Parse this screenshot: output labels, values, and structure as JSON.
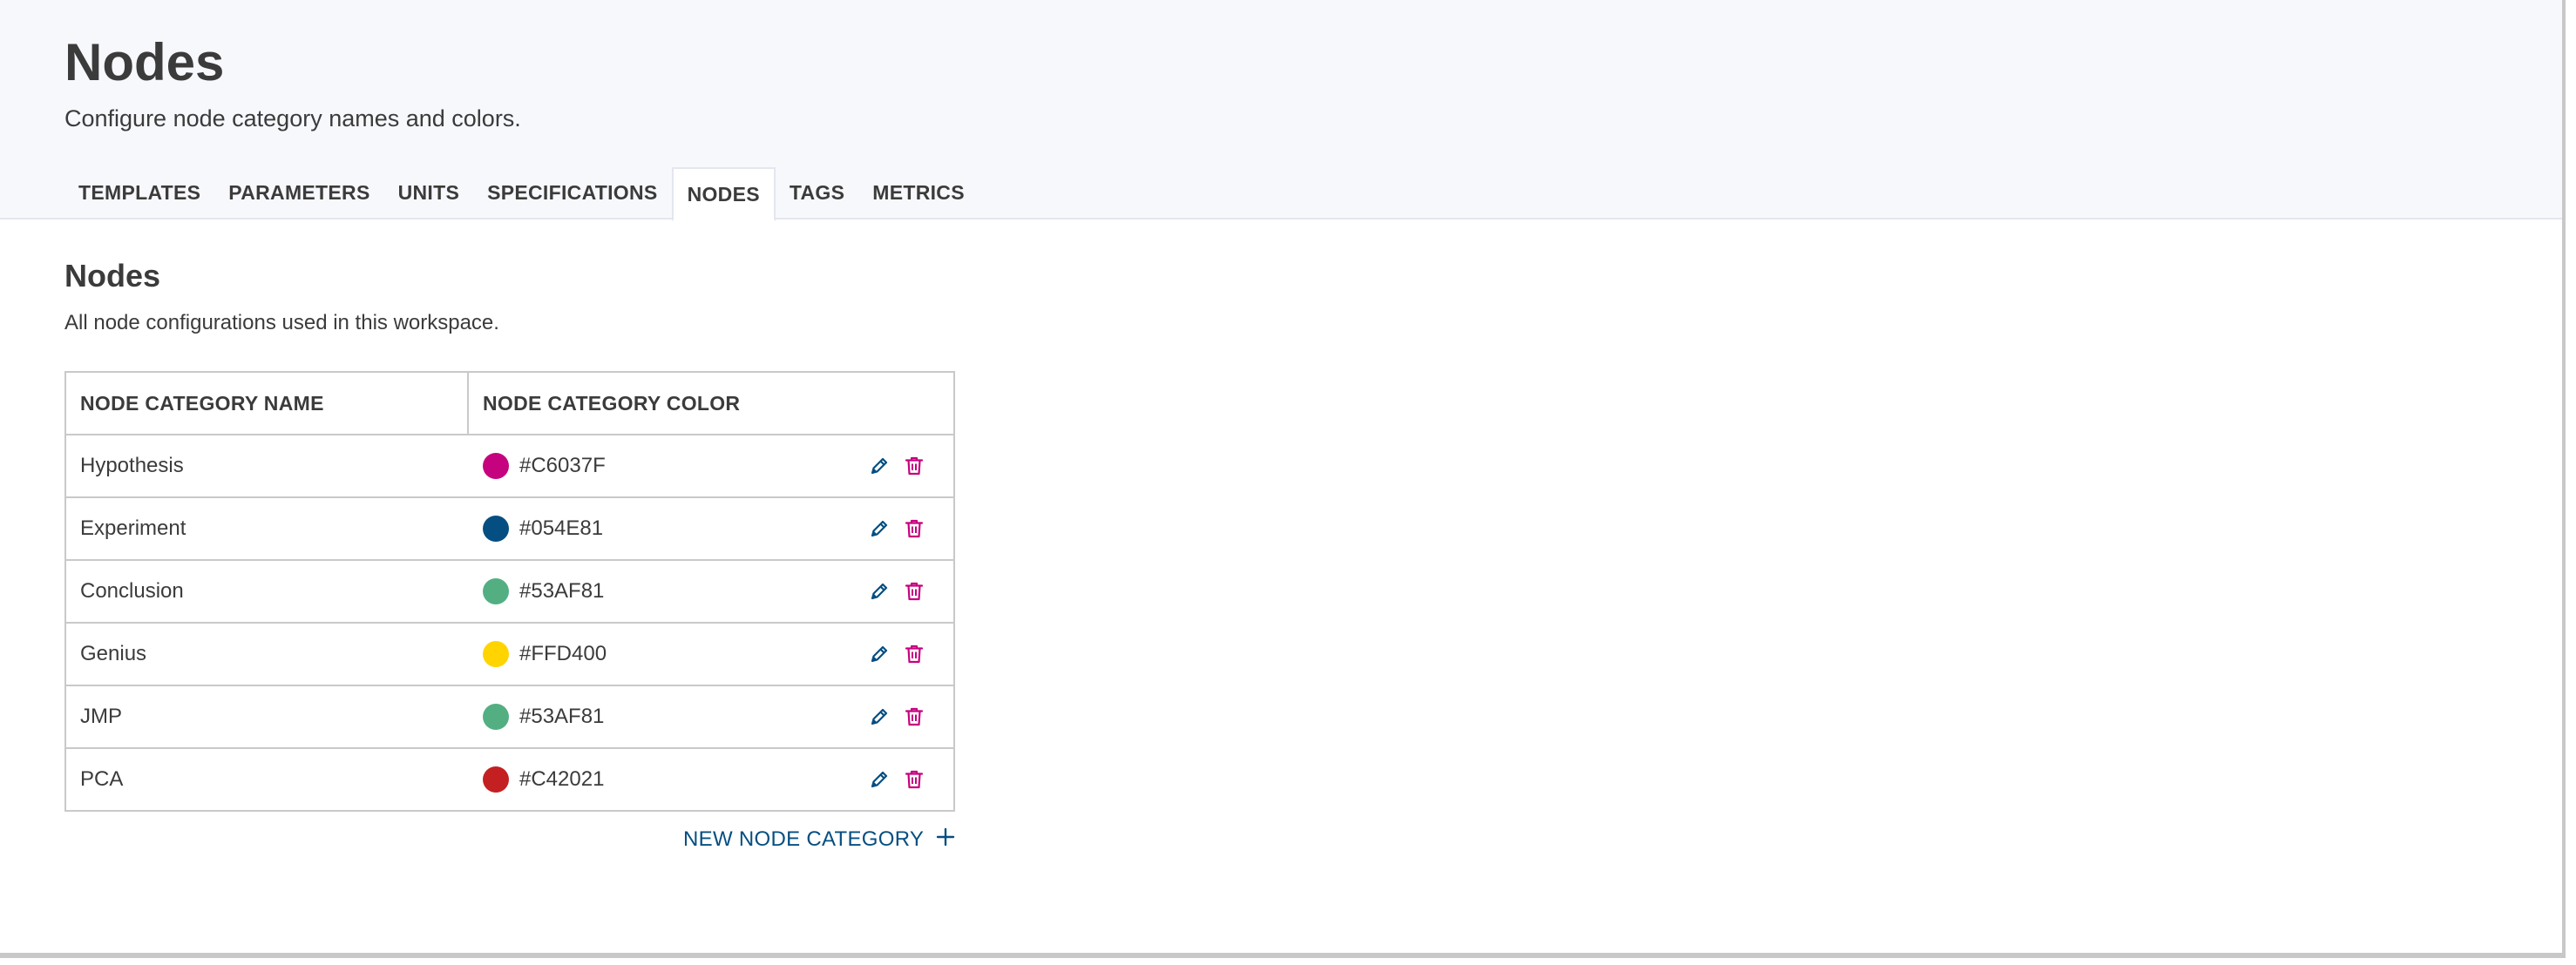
{
  "header": {
    "title": "Nodes",
    "subtitle": "Configure node category names and colors."
  },
  "tabs": [
    {
      "label": "TEMPLATES",
      "active": false
    },
    {
      "label": "PARAMETERS",
      "active": false
    },
    {
      "label": "UNITS",
      "active": false
    },
    {
      "label": "SPECIFICATIONS",
      "active": false
    },
    {
      "label": "NODES",
      "active": true
    },
    {
      "label": "TAGS",
      "active": false
    },
    {
      "label": "METRICS",
      "active": false
    }
  ],
  "section": {
    "title": "Nodes",
    "description": "All node configurations used in this workspace."
  },
  "table": {
    "headers": [
      "NODE CATEGORY NAME",
      "NODE CATEGORY COLOR"
    ],
    "rows": [
      {
        "name": "Hypothesis",
        "color": "#C6037F"
      },
      {
        "name": "Experiment",
        "color": "#054E81"
      },
      {
        "name": "Conclusion",
        "color": "#53AF81"
      },
      {
        "name": "Genius",
        "color": "#FFD400"
      },
      {
        "name": "JMP",
        "color": "#53AF81"
      },
      {
        "name": "PCA",
        "color": "#C42021"
      }
    ]
  },
  "actions": {
    "new_label": "NEW NODE CATEGORY"
  },
  "icons": {
    "edit": "pencil-icon",
    "delete": "trash-icon",
    "add": "plus-icon"
  },
  "colors": {
    "accent": "#054E81",
    "delete": "#C6037F"
  }
}
